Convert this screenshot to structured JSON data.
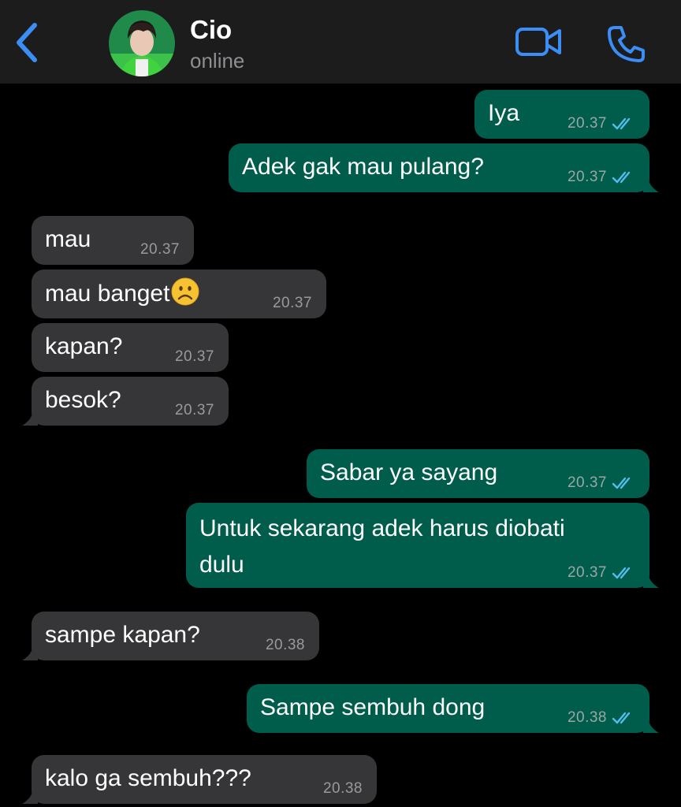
{
  "header": {
    "contact_name": "Cio",
    "status": "online",
    "accent": "#3a8ef5"
  },
  "icons": {
    "back": "chevron-left-icon",
    "video": "video-camera-icon",
    "phone": "phone-icon",
    "read": "double-check-icon"
  },
  "messages": [
    {
      "dir": "out",
      "text": "Iya",
      "time": "20.37",
      "read": true
    },
    {
      "dir": "out",
      "text": "Adek gak mau pulang?",
      "time": "20.37",
      "read": true
    },
    {
      "dir": "in",
      "text": "mau",
      "time": "20.37"
    },
    {
      "dir": "in",
      "text": "mau banget",
      "emoji": "frowning-face",
      "time": "20.37"
    },
    {
      "dir": "in",
      "text": "kapan?",
      "time": "20.37"
    },
    {
      "dir": "in",
      "text": "besok?",
      "time": "20.37"
    },
    {
      "dir": "out",
      "text": "Sabar ya sayang",
      "time": "20.37",
      "read": true
    },
    {
      "dir": "out",
      "text_line1": "Untuk sekarang adek harus diobati",
      "text_line2": "dulu",
      "time": "20.37",
      "read": true
    },
    {
      "dir": "in",
      "text": "sampe kapan?",
      "time": "20.38"
    },
    {
      "dir": "out",
      "text": "Sampe sembuh dong",
      "time": "20.38",
      "read": true
    },
    {
      "dir": "in",
      "text": "kalo ga sembuh???",
      "time": "20.38"
    }
  ]
}
